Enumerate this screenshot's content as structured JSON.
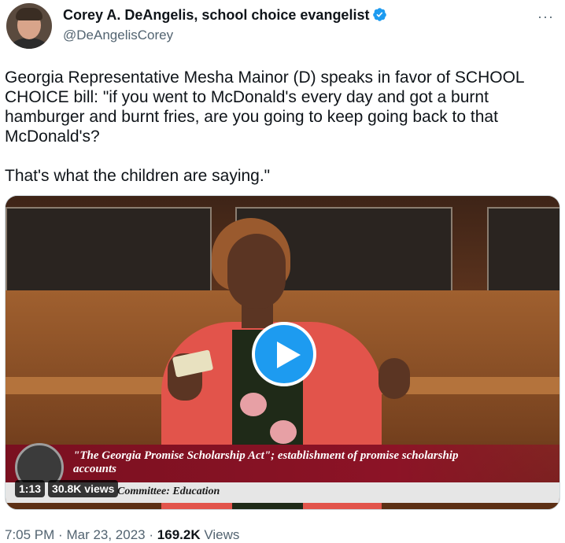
{
  "author": {
    "display_name": "Corey A. DeAngelis, school choice evangelist",
    "handle": "@DeAngelisCorey",
    "verified_icon": "verified-badge-icon",
    "more_label": "···"
  },
  "tweet": {
    "paragraphs": [
      "Georgia Representative Mesha Mainor (D) speaks in favor of SCHOOL CHOICE bill: \"if you went to McDonald's every day and got a burnt hamburger and burnt fries, are you going to keep going back to that McDonald's?",
      "That's what the children are saying.\""
    ]
  },
  "video": {
    "duration": "1:13",
    "views": "30.8K views",
    "caption_line": "\"The Georgia Promise Scholarship Act\"; establishment of promise scholarship accounts",
    "caption_bar": "Committee: Education",
    "play_icon": "play-icon"
  },
  "meta": {
    "time": "7:05 PM",
    "separator": "·",
    "date": "Mar 23, 2023",
    "views_count": "169.2K",
    "views_label": "Views"
  },
  "colors": {
    "accent": "#1d9bf0",
    "secondary_text": "#536471",
    "lower_third": "#8c1326"
  }
}
